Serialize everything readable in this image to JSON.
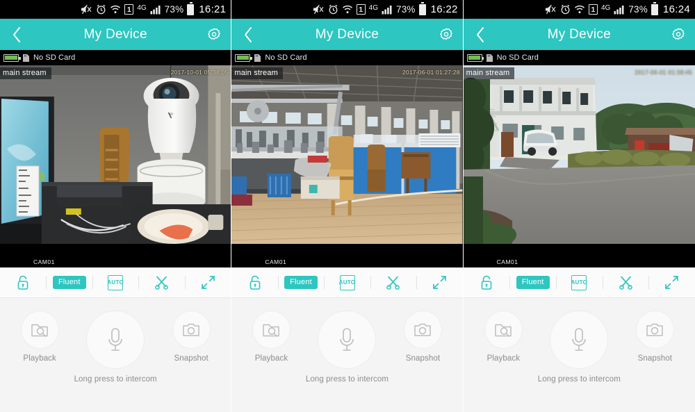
{
  "app": {
    "header_title": "My Device",
    "back_icon": "chevron-left-icon",
    "gear_icon": "gear-icon",
    "accent_color": "#2dc6c0",
    "sd_status": "No SD Card",
    "stream_label": "main stream",
    "camera_label": "CAM01"
  },
  "statusbar": {
    "icons": [
      "mute-icon",
      "alarm-clock-icon",
      "wifi-icon",
      "sim-card-icon",
      "network-type"
    ],
    "sim_number": "1",
    "network": "4G",
    "battery_percent": "73%"
  },
  "toolbar": {
    "lock_label": "lock-icon",
    "quality_label": "Fluent",
    "auto_label": "AUTO",
    "snip_label": "scissors-icon",
    "fullscreen_label": "fullscreen-icon"
  },
  "controls": {
    "playback_label": "Playback",
    "intercom_label": "Long press to intercom",
    "snapshot_label": "Snapshot"
  },
  "panels": [
    {
      "time": "16:21",
      "timestamp": "2017-10-01 05:38:05",
      "scene": "indoor-ptz-camera"
    },
    {
      "time": "16:22",
      "timestamp": "2017-06-01 01:27:28",
      "scene": "indoor-workshop"
    },
    {
      "time": "16:24",
      "timestamp": "2017-06-01 01:38:45",
      "scene": "outdoor-building"
    }
  ]
}
